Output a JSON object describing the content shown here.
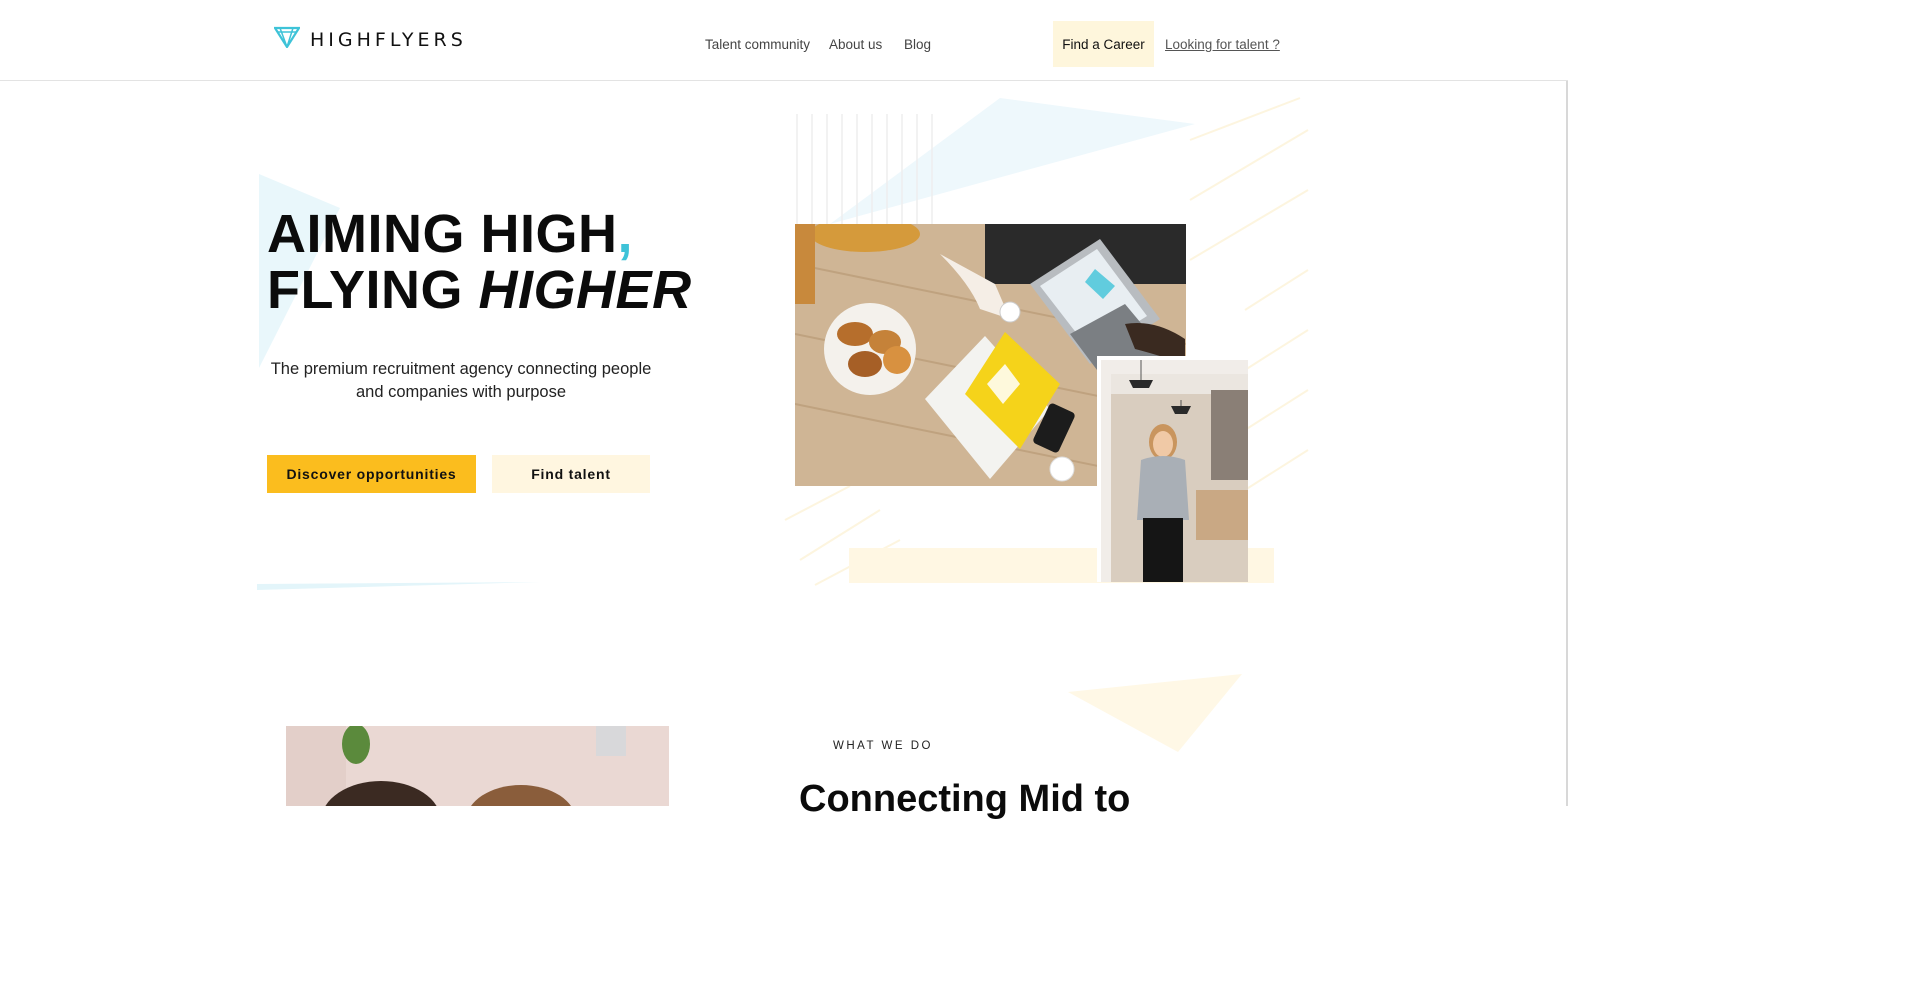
{
  "brand": {
    "name": "HIGHFLYERS",
    "accent": "#3ec3d8",
    "yellow": "#fbbd1e"
  },
  "nav": {
    "items": [
      "Talent community",
      "About us",
      "Blog"
    ],
    "career_button": "Find a Career",
    "talent_link": "Looking for talent ?"
  },
  "hero": {
    "line1": "AIMING HIGH",
    "comma": ",",
    "line2_a": "FLYING ",
    "line2_b": "HIGHER",
    "subtitle": "The premium recruitment agency connecting people and companies with purpose",
    "primary_button": "Discover opportunities",
    "secondary_button": "Find talent"
  },
  "section2": {
    "eyebrow": "WHAT WE DO",
    "title": "Connecting Mid to"
  }
}
